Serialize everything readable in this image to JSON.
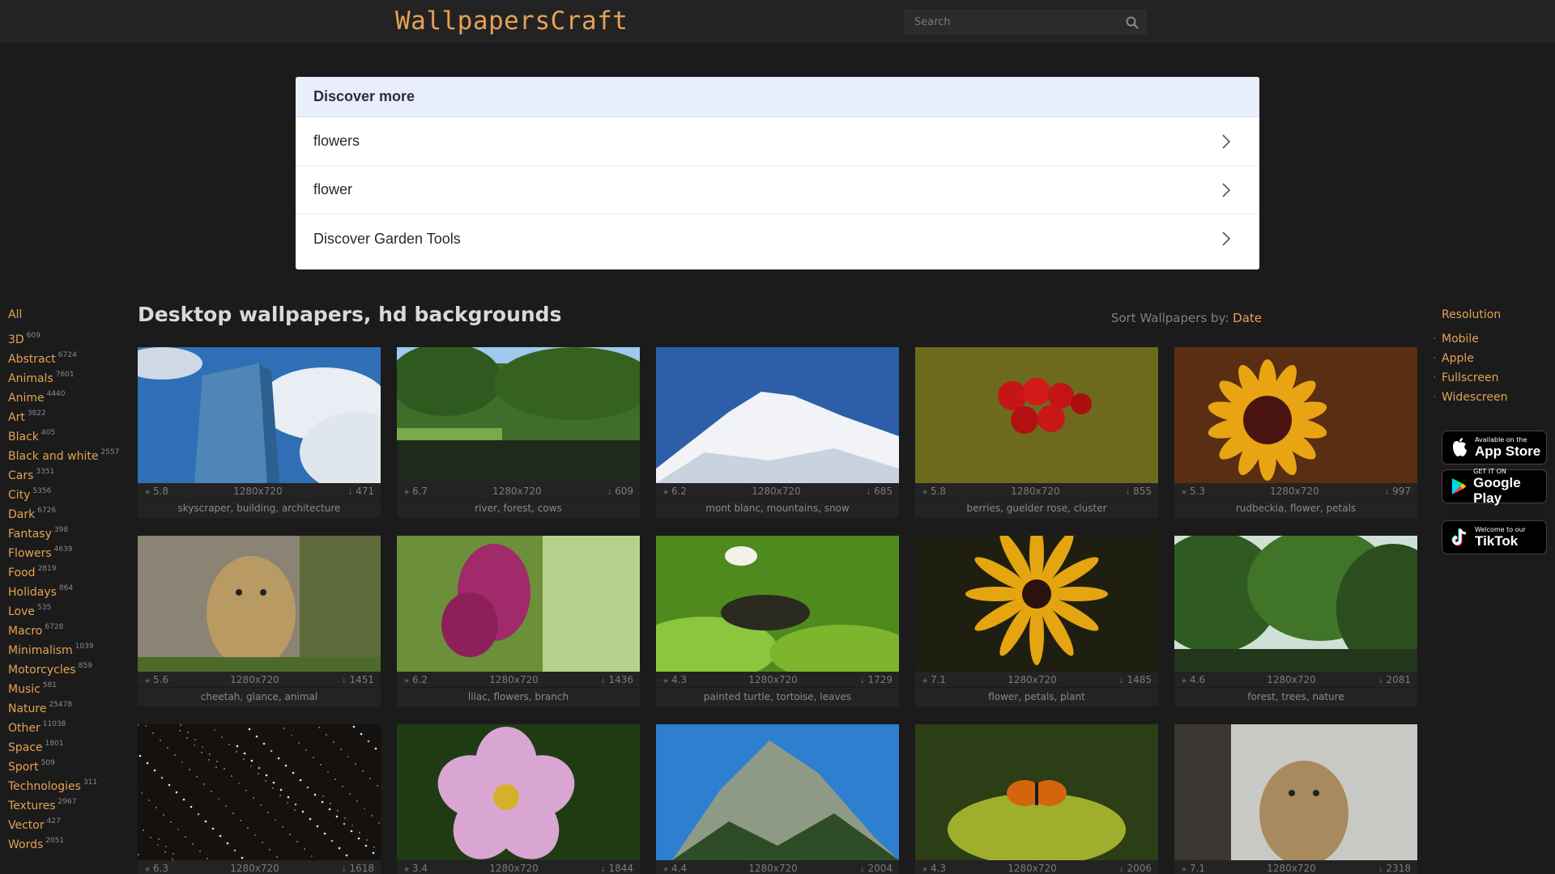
{
  "header": {
    "logo": "WallpapersCraft",
    "search_placeholder": "Search"
  },
  "discover": {
    "title": "Discover more",
    "items": [
      {
        "label": "flowers"
      },
      {
        "label": "flower"
      },
      {
        "label": "Discover Garden Tools"
      }
    ]
  },
  "categories": {
    "all": "All",
    "items": [
      {
        "name": "3D",
        "count": "609"
      },
      {
        "name": "Abstract",
        "count": "6724"
      },
      {
        "name": "Animals",
        "count": "7601"
      },
      {
        "name": "Anime",
        "count": "4440"
      },
      {
        "name": "Art",
        "count": "3822"
      },
      {
        "name": "Black",
        "count": "405"
      },
      {
        "name": "Black and white",
        "count": "2557"
      },
      {
        "name": "Cars",
        "count": "3351"
      },
      {
        "name": "City",
        "count": "5356"
      },
      {
        "name": "Dark",
        "count": "6726"
      },
      {
        "name": "Fantasy",
        "count": "398"
      },
      {
        "name": "Flowers",
        "count": "4639"
      },
      {
        "name": "Food",
        "count": "2819"
      },
      {
        "name": "Holidays",
        "count": "864"
      },
      {
        "name": "Love",
        "count": "535"
      },
      {
        "name": "Macro",
        "count": "6728"
      },
      {
        "name": "Minimalism",
        "count": "1039"
      },
      {
        "name": "Motorcycles",
        "count": "859"
      },
      {
        "name": "Music",
        "count": "581"
      },
      {
        "name": "Nature",
        "count": "25478"
      },
      {
        "name": "Other",
        "count": "11038"
      },
      {
        "name": "Space",
        "count": "1801"
      },
      {
        "name": "Sport",
        "count": "509"
      },
      {
        "name": "Technologies",
        "count": "311"
      },
      {
        "name": "Textures",
        "count": "2967"
      },
      {
        "name": "Vector",
        "count": "427"
      },
      {
        "name": "Words",
        "count": "2051"
      }
    ]
  },
  "main": {
    "title": "Desktop wallpapers, hd backgrounds",
    "sort_label": "Sort Wallpapers by:",
    "sort_value": "Date",
    "wallpapers": [
      {
        "rating": "5.8",
        "resolution": "1280x720",
        "downloads": "471",
        "tags": "skyscraper, building, architecture",
        "scene": "skyscraper"
      },
      {
        "rating": "6.7",
        "resolution": "1280x720",
        "downloads": "609",
        "tags": "river, forest, cows",
        "scene": "river"
      },
      {
        "rating": "6.2",
        "resolution": "1280x720",
        "downloads": "685",
        "tags": "mont blanc, mountains, snow",
        "scene": "snow"
      },
      {
        "rating": "5.8",
        "resolution": "1280x720",
        "downloads": "855",
        "tags": "berries, guelder rose, cluster",
        "scene": "berries"
      },
      {
        "rating": "5.3",
        "resolution": "1280x720",
        "downloads": "997",
        "tags": "rudbeckia, flower, petals",
        "scene": "sunflower"
      },
      {
        "rating": "5.6",
        "resolution": "1280x720",
        "downloads": "1451",
        "tags": "cheetah, glance, animal",
        "scene": "cheetah"
      },
      {
        "rating": "6.2",
        "resolution": "1280x720",
        "downloads": "1436",
        "tags": "lilac, flowers, branch",
        "scene": "lilac"
      },
      {
        "rating": "4.3",
        "resolution": "1280x720",
        "downloads": "1729",
        "tags": "painted turtle, tortoise, leaves",
        "scene": "turtle"
      },
      {
        "rating": "7.1",
        "resolution": "1280x720",
        "downloads": "1485",
        "tags": "flower, petals, plant",
        "scene": "yellowflower"
      },
      {
        "rating": "4.6",
        "resolution": "1280x720",
        "downloads": "2081",
        "tags": "forest, trees, nature",
        "scene": "forest"
      },
      {
        "rating": "6.3",
        "resolution": "1280x720",
        "downloads": "1618",
        "tags": "",
        "scene": "stars"
      },
      {
        "rating": "3.4",
        "resolution": "1280x720",
        "downloads": "1844",
        "tags": "",
        "scene": "pinkflower"
      },
      {
        "rating": "4.4",
        "resolution": "1280x720",
        "downloads": "2004",
        "tags": "",
        "scene": "mountain"
      },
      {
        "rating": "4.3",
        "resolution": "1280x720",
        "downloads": "2006",
        "tags": "",
        "scene": "butterfly"
      },
      {
        "rating": "7.1",
        "resolution": "1280x720",
        "downloads": "2318",
        "tags": "",
        "scene": "cub"
      }
    ]
  },
  "resolution": {
    "title": "Resolution",
    "items": [
      {
        "label": "Mobile"
      },
      {
        "label": "Apple"
      },
      {
        "label": "Fullscreen"
      },
      {
        "label": "Widescreen"
      }
    ]
  },
  "stores": {
    "appstore_small": "Available on the",
    "appstore_big": "App Store",
    "googleplay_small": "GET IT ON",
    "googleplay_big": "Google Play",
    "tiktok_small": "Welcome to our",
    "tiktok_big": "TikTok"
  },
  "colors": {
    "accent": "#e6a155",
    "background": "#1b1b1b",
    "header": "#232323"
  }
}
